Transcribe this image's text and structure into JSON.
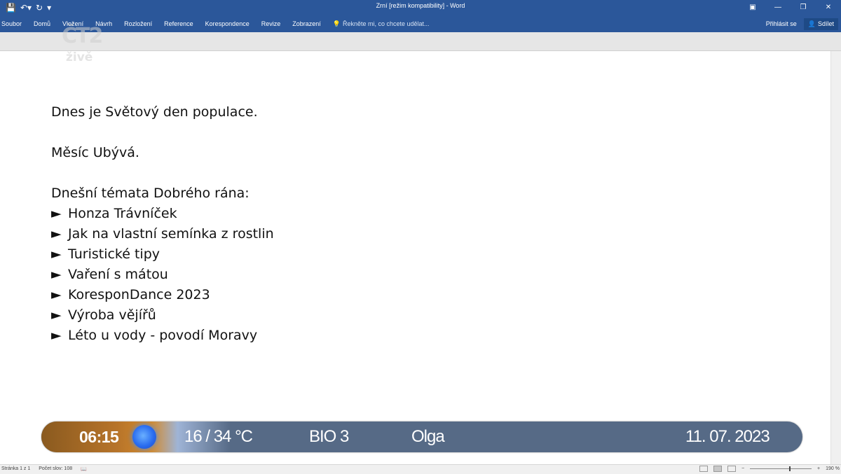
{
  "titlebar": {
    "title": "Zrní [režim kompatibility] - Word",
    "qat_icons": {
      "save": "save-icon",
      "undo": "undo-icon",
      "redo": "redo-icon",
      "customize": "customize-icon"
    },
    "controls": {
      "ribbon_options": "▣",
      "minimize": "—",
      "restore": "❐",
      "close": "✕"
    }
  },
  "ribbon": {
    "tabs": [
      "Soubor",
      "Domů",
      "Vložení",
      "Návrh",
      "Rozložení",
      "Reference",
      "Korespondence",
      "Revize",
      "Zobrazení"
    ],
    "tell_me": "Řekněte mi, co chcete udělat...",
    "sign_in": "Přihlásit se",
    "share": "Sdílet"
  },
  "logo": {
    "mark": "ČT2",
    "sub": "živě"
  },
  "document": {
    "lines": [
      "Dnes je Světový den populace.",
      "Měsíc Ubývá.",
      "Dnešní témata Dobrého rána:"
    ],
    "bullet": "►",
    "topics": [
      "Honza Trávníček",
      "Jak na vlastní semínka z rostlin",
      "Turistické tipy",
      "Vaření s mátou",
      "KoresponDance 2023",
      "Výroba vějířů",
      "Léto u vody - povodí Moravy"
    ]
  },
  "infobar": {
    "time": "06:15",
    "temperature": "16 / 34 °C",
    "bio": "BIO 3",
    "nameday": "Olga",
    "date": "11. 07. 2023"
  },
  "statusbar": {
    "page": "Stránka 1 z 1",
    "words": "Počet slov: 108",
    "zoom": "190 %",
    "zoom_minus": "−",
    "zoom_plus": "+"
  }
}
